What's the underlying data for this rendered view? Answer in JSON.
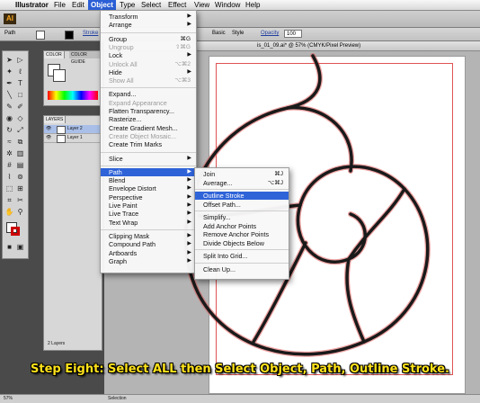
{
  "menubar": {
    "apple": "",
    "items": [
      "Illustrator",
      "File",
      "Edit",
      "Object",
      "Type",
      "Select",
      "Effect",
      "View",
      "Window",
      "Help"
    ],
    "active": "Object"
  },
  "appbar": {
    "logo": "AI"
  },
  "control_bar": {
    "mode_label": "Path",
    "stroke_label": "Stroke",
    "basic_label": "Basic",
    "style_label": "Style",
    "opacity_label": "Opacity",
    "opacity_value": "100"
  },
  "panels": {
    "color_tab_1": "COLOR",
    "color_tab_2": "COLOR GUIDE",
    "layers_tab": "LAYERS",
    "layers": [
      "Layer 2",
      "Layer 1"
    ],
    "layer_count": "2 Layers"
  },
  "document": {
    "title": "is_01_09.ai* @ 57% (CMYK/Pixel Preview)"
  },
  "status_bar": {
    "zoom": "57%",
    "tool": "Selection"
  },
  "object_menu": {
    "items": [
      {
        "label": "Transform",
        "arrow": true
      },
      {
        "label": "Arrange",
        "arrow": true
      },
      {
        "sep": true
      },
      {
        "label": "Group",
        "shortcut": "⌘G"
      },
      {
        "label": "Ungroup",
        "shortcut": "⇧⌘G",
        "disabled": true
      },
      {
        "label": "Lock",
        "arrow": true
      },
      {
        "label": "Unlock All",
        "shortcut": "⌥⌘2",
        "disabled": true
      },
      {
        "label": "Hide",
        "arrow": true
      },
      {
        "label": "Show All",
        "shortcut": "⌥⌘3",
        "disabled": true
      },
      {
        "sep": true
      },
      {
        "label": "Expand..."
      },
      {
        "label": "Expand Appearance",
        "disabled": true
      },
      {
        "label": "Flatten Transparency..."
      },
      {
        "label": "Rasterize..."
      },
      {
        "label": "Create Gradient Mesh..."
      },
      {
        "label": "Create Object Mosaic...",
        "disabled": true
      },
      {
        "label": "Create Trim Marks"
      },
      {
        "sep": true
      },
      {
        "label": "Slice",
        "arrow": true
      },
      {
        "sep": true
      },
      {
        "label": "Path",
        "arrow": true,
        "highlighted": true
      },
      {
        "label": "Blend",
        "arrow": true
      },
      {
        "label": "Envelope Distort",
        "arrow": true
      },
      {
        "label": "Perspective",
        "arrow": true
      },
      {
        "label": "Live Paint",
        "arrow": true
      },
      {
        "label": "Live Trace",
        "arrow": true
      },
      {
        "label": "Text Wrap",
        "arrow": true
      },
      {
        "sep": true
      },
      {
        "label": "Clipping Mask",
        "arrow": true
      },
      {
        "label": "Compound Path",
        "arrow": true
      },
      {
        "label": "Artboards",
        "arrow": true
      },
      {
        "label": "Graph",
        "arrow": true
      }
    ]
  },
  "path_menu": {
    "items": [
      {
        "label": "Join",
        "shortcut": "⌘J"
      },
      {
        "label": "Average...",
        "shortcut": "⌥⌘J"
      },
      {
        "sep": true
      },
      {
        "label": "Outline Stroke",
        "highlighted": true
      },
      {
        "label": "Offset Path..."
      },
      {
        "sep": true
      },
      {
        "label": "Simplify..."
      },
      {
        "label": "Add Anchor Points"
      },
      {
        "label": "Remove Anchor Points"
      },
      {
        "label": "Divide Objects Below"
      },
      {
        "sep": true
      },
      {
        "label": "Split Into Grid..."
      },
      {
        "sep": true
      },
      {
        "label": "Clean Up..."
      }
    ]
  },
  "caption": "Step Eight:  Select ALL then Select Object, Path, Outline Stroke.",
  "colors": {
    "highlight": "#2f63d8",
    "caption": "#ffe21a",
    "artboard_border": "#e05353",
    "art_stroke": "#1a1a1a"
  }
}
